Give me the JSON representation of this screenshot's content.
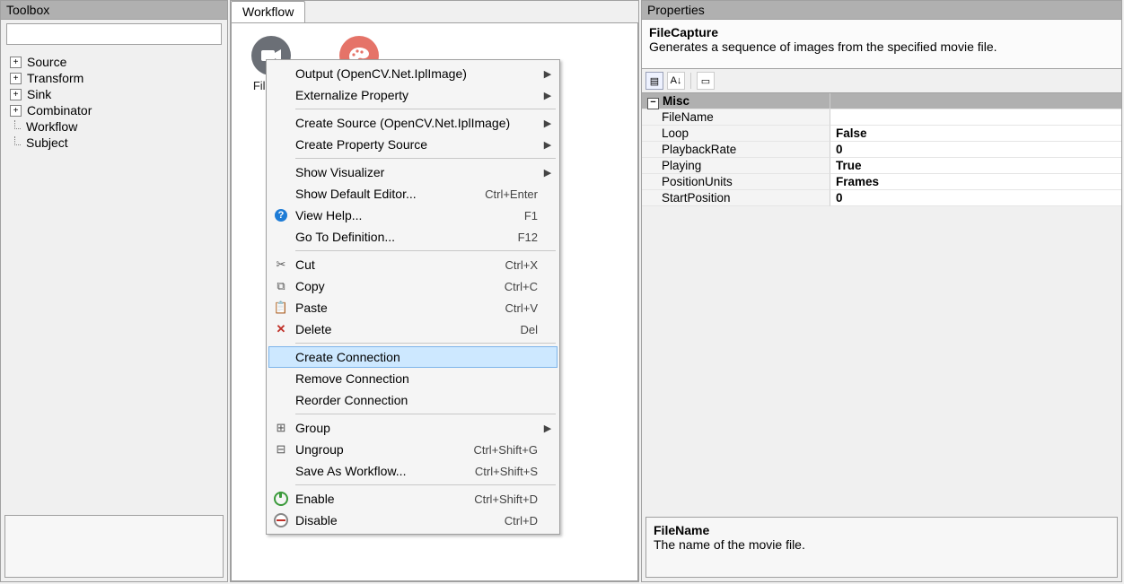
{
  "toolbox": {
    "title": "Toolbox",
    "search_placeholder": "",
    "items": [
      {
        "label": "Source",
        "expandable": true
      },
      {
        "label": "Transform",
        "expandable": true
      },
      {
        "label": "Sink",
        "expandable": true
      },
      {
        "label": "Combinator",
        "expandable": true
      },
      {
        "label": "Workflow",
        "expandable": false
      },
      {
        "label": "Subject",
        "expandable": false
      }
    ]
  },
  "workflow": {
    "tab_label": "Workflow",
    "nodes": [
      {
        "id": "node-filecapture",
        "label": "FileCapture",
        "color": "#6b6f76",
        "icon": "camera"
      },
      {
        "id": "node-colorbalance",
        "label": "",
        "color": "#e57368",
        "icon": "palette"
      }
    ]
  },
  "context_menu": {
    "highlighted": "Create Connection",
    "groups": [
      [
        {
          "label": "Output (OpenCV.Net.IplImage)",
          "submenu": true
        },
        {
          "label": "Externalize Property",
          "submenu": true
        }
      ],
      [
        {
          "label": "Create Source (OpenCV.Net.IplImage)",
          "submenu": true
        },
        {
          "label": "Create Property Source",
          "submenu": true
        }
      ],
      [
        {
          "label": "Show Visualizer",
          "submenu": true
        },
        {
          "label": "Show Default Editor...",
          "shortcut": "Ctrl+Enter"
        },
        {
          "label": "View Help...",
          "shortcut": "F1",
          "icon": "help"
        },
        {
          "label": "Go To Definition...",
          "shortcut": "F12"
        }
      ],
      [
        {
          "label": "Cut",
          "shortcut": "Ctrl+X",
          "icon": "cut"
        },
        {
          "label": "Copy",
          "shortcut": "Ctrl+C",
          "icon": "copy"
        },
        {
          "label": "Paste",
          "shortcut": "Ctrl+V",
          "icon": "paste"
        },
        {
          "label": "Delete",
          "shortcut": "Del",
          "icon": "delete"
        }
      ],
      [
        {
          "label": "Create Connection",
          "highlight": true
        },
        {
          "label": "Remove Connection"
        },
        {
          "label": "Reorder Connection"
        }
      ],
      [
        {
          "label": "Group",
          "submenu": true,
          "icon": "group"
        },
        {
          "label": "Ungroup",
          "shortcut": "Ctrl+Shift+G",
          "icon": "ungroup"
        },
        {
          "label": "Save As Workflow...",
          "shortcut": "Ctrl+Shift+S"
        }
      ],
      [
        {
          "label": "Enable",
          "shortcut": "Ctrl+Shift+D",
          "icon": "enable"
        },
        {
          "label": "Disable",
          "shortcut": "Ctrl+D",
          "icon": "disable"
        }
      ]
    ]
  },
  "properties": {
    "title": "Properties",
    "component": "FileCapture",
    "description": "Generates a sequence of images from the specified movie file.",
    "category": "Misc",
    "rows": [
      {
        "name": "FileName",
        "value": ""
      },
      {
        "name": "Loop",
        "value": "False",
        "bold": true
      },
      {
        "name": "PlaybackRate",
        "value": "0",
        "bold": true
      },
      {
        "name": "Playing",
        "value": "True",
        "bold": true
      },
      {
        "name": "PositionUnits",
        "value": "Frames",
        "bold": true
      },
      {
        "name": "StartPosition",
        "value": "0",
        "bold": true
      }
    ],
    "help": {
      "title": "FileName",
      "text": "The name of the movie file."
    }
  }
}
